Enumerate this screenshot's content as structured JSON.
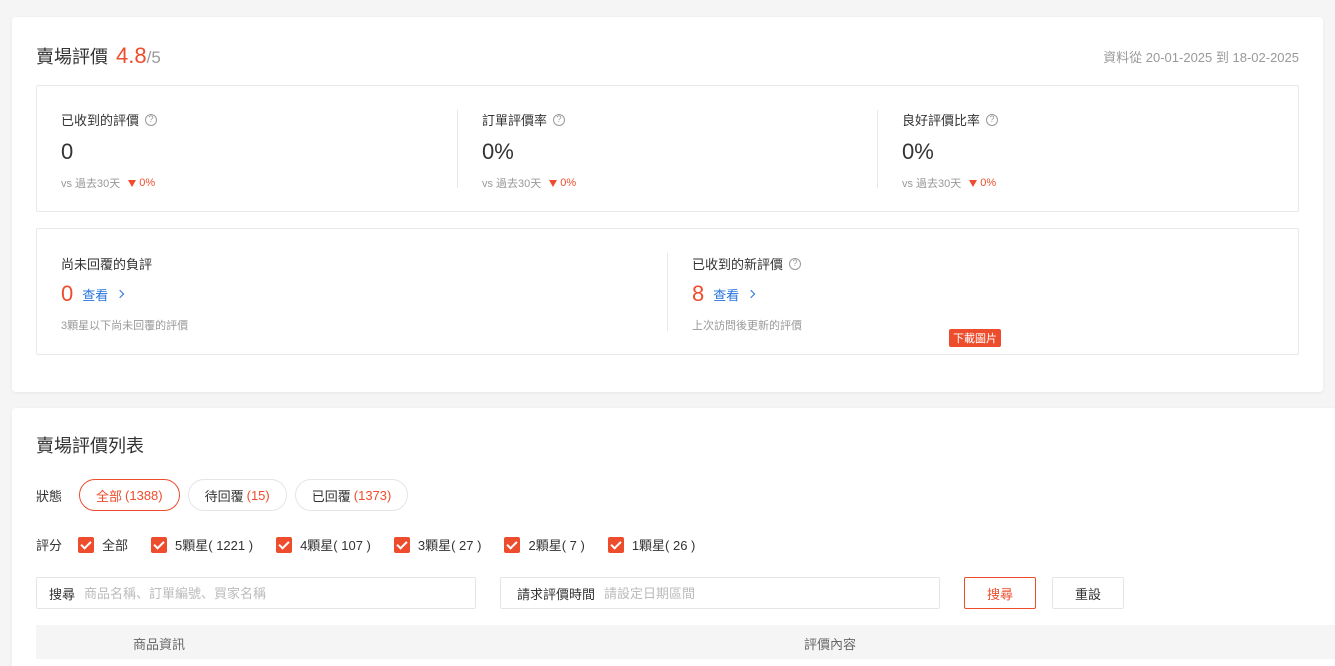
{
  "summary": {
    "title": "賣場評價",
    "score": "4.8",
    "score_total": "/5",
    "date_range": "資料從 20-01-2025 到 18-02-2025",
    "metrics": [
      {
        "label": "已收到的評價",
        "value": "0",
        "vs": "vs 過去30天",
        "change": "0%"
      },
      {
        "label": "訂單評價率",
        "value": "0%",
        "vs": "vs 過去30天",
        "change": "0%"
      },
      {
        "label": "良好評價比率",
        "value": "0%",
        "vs": "vs 過去30天",
        "change": "0%"
      }
    ],
    "help_glyph": "?",
    "unreplied": {
      "label": "尚未回覆的負評",
      "count": "0",
      "link": "查看",
      "desc": "3顆星以下尚未回覆的評價"
    },
    "new_reviews": {
      "label": "已收到的新評價",
      "count": "8",
      "link": "查看",
      "desc": "上次訪問後更新的評價"
    },
    "download_tag": "下載圖片"
  },
  "list": {
    "title": "賣場評價列表",
    "status_label": "狀態",
    "status_tabs": [
      {
        "label": "全部",
        "count": "(1388)",
        "active": true
      },
      {
        "label": "待回覆",
        "count": "(15)",
        "active": false
      },
      {
        "label": "已回覆",
        "count": "(1373)",
        "active": false
      }
    ],
    "rating_label": "評分",
    "ratings": [
      {
        "label": "全部",
        "checked": true
      },
      {
        "label": "5顆星( 1221 )",
        "checked": true
      },
      {
        "label": "4顆星( 107 )",
        "checked": true
      },
      {
        "label": "3顆星( 27 )",
        "checked": true
      },
      {
        "label": "2顆星( 7 )",
        "checked": true
      },
      {
        "label": "1顆星( 26 )",
        "checked": true
      }
    ],
    "search": {
      "label": "搜尋",
      "placeholder": "商品名稱、訂單編號、買家名稱"
    },
    "date_filter": {
      "label": "請求評價時間",
      "placeholder": "請設定日期區間"
    },
    "search_button": "搜尋",
    "reset_button": "重設",
    "columns": [
      "商品資訊",
      "評價內容"
    ]
  },
  "colors": {
    "accent": "#ee4d2d",
    "link": "#2673dd"
  }
}
